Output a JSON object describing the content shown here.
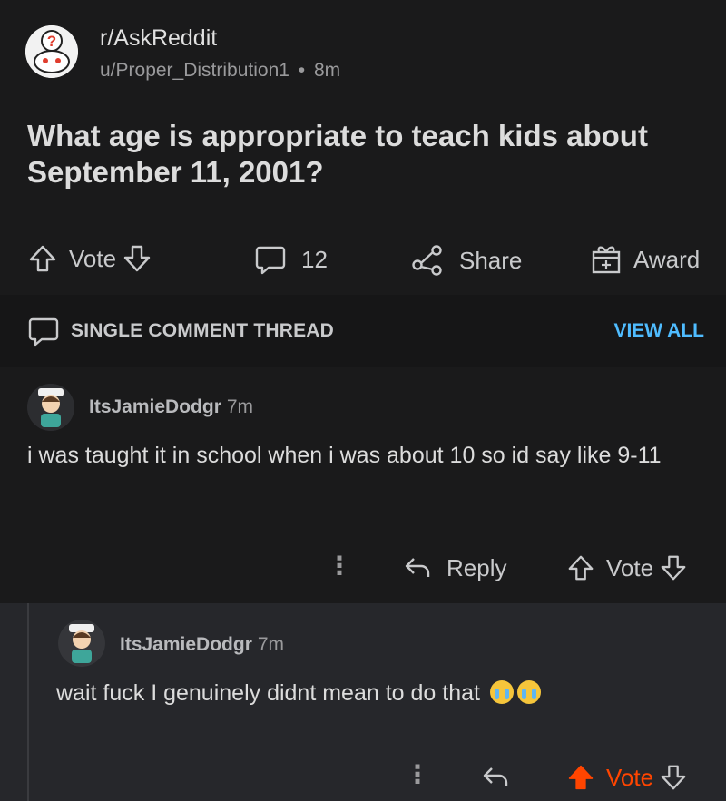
{
  "post": {
    "subreddit": "r/AskReddit",
    "author": "u/Proper_Distribution1",
    "separator": "•",
    "age": "8m",
    "title": "What age is appropriate to teach kids about September 11, 2001?",
    "actions": {
      "vote_label": "Vote",
      "comment_count": "12",
      "share_label": "Share",
      "award_label": "Award"
    }
  },
  "thread": {
    "label": "SINGLE COMMENT THREAD",
    "view_all": "VIEW ALL"
  },
  "comments": [
    {
      "username": "ItsJamieDodgr",
      "age": "7m",
      "body": "i was taught it in school when i was about 10 so id say like 9-11",
      "reply_label": "Reply",
      "vote_label": "Vote"
    },
    {
      "username": "ItsJamieDodgr",
      "age": "7m",
      "body": "wait fuck I genuinely didnt mean to do that",
      "emoji": "crying-face-emoji x2",
      "vote_label": "Vote",
      "upvoted": true
    }
  ],
  "colors": {
    "background": "#1a1a1b",
    "highlight_comment_bg": "#26272b",
    "link_blue": "#4fbcff",
    "upvote_orange": "#ff4500"
  }
}
